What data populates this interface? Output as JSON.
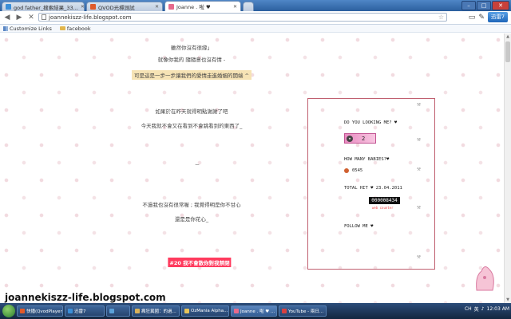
{
  "browser": {
    "tabs": [
      {
        "label": "god father_搜索結果_33...",
        "favicon_color": "#3a8ed8"
      },
      {
        "label": "QVOD光標測試",
        "favicon_color": "#e05a2a"
      },
      {
        "label": "Joanne . 啦 ♥",
        "favicon_color": "#e66a8c"
      }
    ],
    "url": "joannekiszz-life.blogspot.com",
    "toolbar_button": "迅雷7",
    "bookmarks": [
      {
        "label": "Customize Links",
        "icon": "grid-icon"
      },
      {
        "label": "facebook",
        "icon": "folder-icon"
      }
    ]
  },
  "post": {
    "lines": [
      "雖然你沒有很緣」",
      "就像你我的 隨隨意也沒有情 -",
      "可是這是一步一步讓我們的愛情走進婚姻的開端 ^",
      "如果於在昨天就得明點謝謝了吧",
      "今天我就不會又在看到不會跳看到的東西了_",
      "不過我也沒有很常喔 ; 我覺得明是你不甘心",
      "還是是你花心_"
    ],
    "footer_tag": "#20 我不會散你對我禁閉"
  },
  "sidebar": {
    "looking_label": "DO YOU LOOKING ME? ♥",
    "hero_count": "2",
    "babies_label": "HOW MANY BABIES?♥",
    "babies_count": "0545",
    "total_hit_label": "TOTAL HIT ♥ 23.04.2011",
    "hit_counter": "000008434",
    "hit_sub": "web counter",
    "follow_label": "FOLLOW ME ♥"
  },
  "watermark": "joannekiszz-life.blogspot.com",
  "taskbar": {
    "items": [
      {
        "label": "快播(QvodPlayer)",
        "color": "#e05a2a"
      },
      {
        "label": "迅雷7",
        "color": "#3a8ed8"
      },
      {
        "label": "",
        "color": "#5aa0d8"
      },
      {
        "label": "瘋狂異國：的過...",
        "color": "#d9b25a"
      },
      {
        "label": "OzMania Alpha...",
        "color": "#e6c45a"
      },
      {
        "label": "Joanne . 啦 ♥ ...",
        "color": "#e66a8c"
      },
      {
        "label": "YouTube - 兩日...",
        "color": "#d84040"
      }
    ],
    "tray_lang": "CH",
    "tray_text": "英",
    "clock": "12:03 AM"
  }
}
